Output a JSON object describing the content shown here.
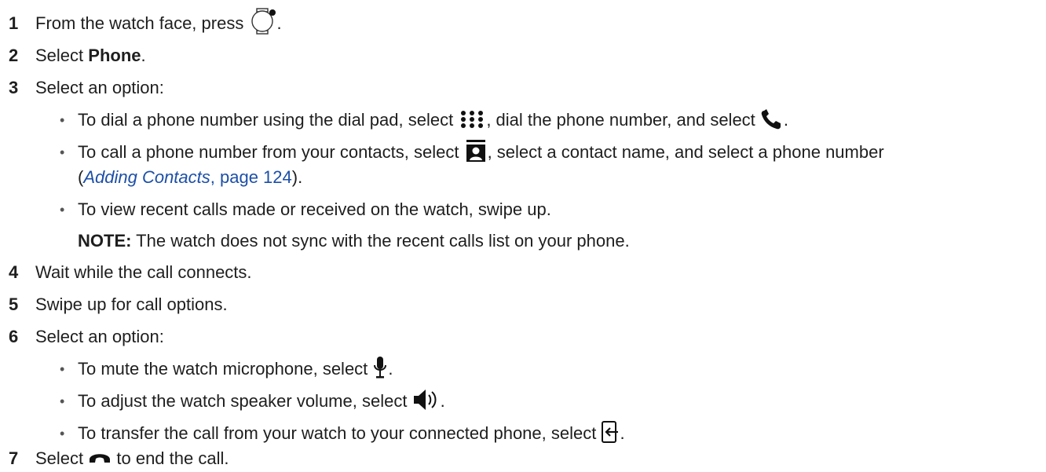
{
  "steps": [
    {
      "num": "1",
      "pre": "From the watch face, press ",
      "icon": "watch-button-icon",
      "post": "."
    },
    {
      "num": "2",
      "pre": "Select ",
      "bold": "Phone",
      "post": "."
    },
    {
      "num": "3",
      "text": "Select an option:"
    },
    {
      "num": "4",
      "text": "Wait while the call connects."
    },
    {
      "num": "5",
      "text": "Swipe up for call options."
    },
    {
      "num": "6",
      "text": "Select an option:"
    },
    {
      "num": "7",
      "pre": "Select ",
      "icon": "end-call-icon",
      "post": " to end the call."
    }
  ],
  "step3_options": [
    {
      "t1": "To dial a phone number using the dial pad, select ",
      "icon1": "dial-pad-icon",
      "t2": ", dial the phone number, and select ",
      "icon2": "phone-call-icon",
      "t3": "."
    },
    {
      "t1": "To call a phone number from your contacts, select ",
      "icon1": "contacts-icon",
      "t2": ", select a contact name, and select a phone number",
      "line2_open": "(",
      "link_title": "Adding Contacts",
      "link_page": ", page 124",
      "line2_close": ")."
    },
    {
      "t1": "To view recent calls made or received on the watch, swipe up."
    }
  ],
  "note": {
    "label": "NOTE:",
    "text": " The watch does not sync with the recent calls list on your phone."
  },
  "step6_options": [
    {
      "t1": "To mute the watch microphone, select ",
      "icon1": "microphone-icon",
      "t3": "."
    },
    {
      "t1": "To adjust the watch speaker volume, select ",
      "icon1": "speaker-volume-icon",
      "t3": "."
    },
    {
      "t1": "To transfer the call from your watch to your connected phone, select ",
      "icon1": "transfer-call-icon",
      "t3": "."
    }
  ],
  "bullet_char": "•",
  "colors": {
    "text": "#1e1e1e",
    "link": "#1c4fa8"
  }
}
